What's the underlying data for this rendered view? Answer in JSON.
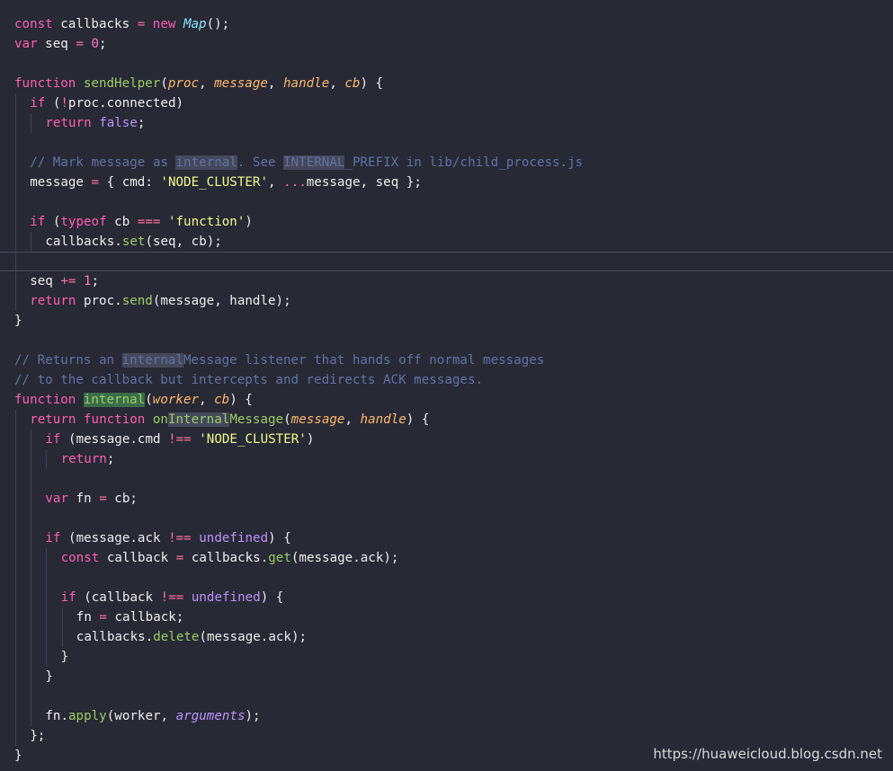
{
  "colors": {
    "background": "#272935",
    "plain": "#eeeeee",
    "keyword": "#ff5faf",
    "control": "#c792ea",
    "function": "#9ccc65",
    "param": "#ffb86c",
    "string": "#f1fa8c",
    "number": "#ff79c6",
    "comment": "#6272a4",
    "class": "#8be9fd",
    "operator": "#ff6e9e",
    "constant": "#bd93f9"
  },
  "watermark": "https://huaweicloud.blog.csdn.net",
  "lines": [
    {
      "indent": 0,
      "tokens": [
        {
          "t": "const",
          "c": "keyword"
        },
        {
          "t": " callbacks ",
          "c": "plain"
        },
        {
          "t": "=",
          "c": "operator"
        },
        {
          "t": " ",
          "c": "plain"
        },
        {
          "t": "new",
          "c": "keyword"
        },
        {
          "t": " ",
          "c": "plain"
        },
        {
          "t": "Map",
          "c": "class"
        },
        {
          "t": "();",
          "c": "plain"
        }
      ]
    },
    {
      "indent": 0,
      "tokens": [
        {
          "t": "var",
          "c": "keyword"
        },
        {
          "t": " seq ",
          "c": "plain"
        },
        {
          "t": "=",
          "c": "operator"
        },
        {
          "t": " ",
          "c": "plain"
        },
        {
          "t": "0",
          "c": "number"
        },
        {
          "t": ";",
          "c": "plain"
        }
      ]
    },
    {
      "indent": 0,
      "tokens": []
    },
    {
      "indent": 0,
      "tokens": [
        {
          "t": "function",
          "c": "keyword"
        },
        {
          "t": " ",
          "c": "plain"
        },
        {
          "t": "sendHelper",
          "c": "function"
        },
        {
          "t": "(",
          "c": "plain"
        },
        {
          "t": "proc",
          "c": "param"
        },
        {
          "t": ", ",
          "c": "plain"
        },
        {
          "t": "message",
          "c": "param"
        },
        {
          "t": ", ",
          "c": "plain"
        },
        {
          "t": "handle",
          "c": "param"
        },
        {
          "t": ", ",
          "c": "plain"
        },
        {
          "t": "cb",
          "c": "param"
        },
        {
          "t": ") {",
          "c": "plain"
        }
      ]
    },
    {
      "indent": 1,
      "tokens": [
        {
          "t": "if",
          "c": "keyword"
        },
        {
          "t": " (",
          "c": "plain"
        },
        {
          "t": "!",
          "c": "operator"
        },
        {
          "t": "proc.connected)",
          "c": "plain"
        }
      ]
    },
    {
      "indent": 2,
      "tokens": [
        {
          "t": "return",
          "c": "keyword"
        },
        {
          "t": " ",
          "c": "plain"
        },
        {
          "t": "false",
          "c": "constant"
        },
        {
          "t": ";",
          "c": "plain"
        }
      ]
    },
    {
      "indent": 1,
      "tokens": []
    },
    {
      "indent": 1,
      "tokens": [
        {
          "t": "// Mark message as ",
          "c": "comment"
        },
        {
          "t": "internal",
          "c": "comment",
          "hl": true
        },
        {
          "t": ". See ",
          "c": "comment"
        },
        {
          "t": "INTERNAL",
          "c": "comment",
          "hl": true
        },
        {
          "t": "_PREFIX in lib/child_process.js",
          "c": "comment"
        }
      ]
    },
    {
      "indent": 1,
      "tokens": [
        {
          "t": "message ",
          "c": "plain"
        },
        {
          "t": "=",
          "c": "operator"
        },
        {
          "t": " { cmd: ",
          "c": "plain"
        },
        {
          "t": "'NODE_CLUSTER'",
          "c": "string"
        },
        {
          "t": ", ",
          "c": "plain"
        },
        {
          "t": "...",
          "c": "operator"
        },
        {
          "t": "message, seq };",
          "c": "plain"
        }
      ]
    },
    {
      "indent": 1,
      "tokens": []
    },
    {
      "indent": 1,
      "tokens": [
        {
          "t": "if",
          "c": "keyword"
        },
        {
          "t": " (",
          "c": "plain"
        },
        {
          "t": "typeof",
          "c": "keyword"
        },
        {
          "t": " cb ",
          "c": "plain"
        },
        {
          "t": "===",
          "c": "operator"
        },
        {
          "t": " ",
          "c": "plain"
        },
        {
          "t": "'function'",
          "c": "string"
        },
        {
          "t": ")",
          "c": "plain"
        }
      ]
    },
    {
      "indent": 2,
      "tokens": [
        {
          "t": "callbacks.",
          "c": "plain"
        },
        {
          "t": "set",
          "c": "function"
        },
        {
          "t": "(seq, cb);",
          "c": "plain"
        }
      ]
    },
    {
      "indent": 1,
      "tokens": [],
      "current": true
    },
    {
      "indent": 1,
      "tokens": [
        {
          "t": "seq ",
          "c": "plain"
        },
        {
          "t": "+=",
          "c": "operator"
        },
        {
          "t": " ",
          "c": "plain"
        },
        {
          "t": "1",
          "c": "number"
        },
        {
          "t": ";",
          "c": "plain"
        }
      ]
    },
    {
      "indent": 1,
      "tokens": [
        {
          "t": "return",
          "c": "keyword"
        },
        {
          "t": " proc.",
          "c": "plain"
        },
        {
          "t": "send",
          "c": "function"
        },
        {
          "t": "(message, handle);",
          "c": "plain"
        }
      ]
    },
    {
      "indent": 0,
      "tokens": [
        {
          "t": "}",
          "c": "plain"
        }
      ]
    },
    {
      "indent": 0,
      "tokens": []
    },
    {
      "indent": 0,
      "tokens": [
        {
          "t": "// Returns an ",
          "c": "comment"
        },
        {
          "t": "internal",
          "c": "comment",
          "hl": true
        },
        {
          "t": "Message listener that hands off normal messages",
          "c": "comment"
        }
      ]
    },
    {
      "indent": 0,
      "tokens": [
        {
          "t": "// to the callback but intercepts and redirects ACK messages.",
          "c": "comment"
        }
      ]
    },
    {
      "indent": 0,
      "tokens": [
        {
          "t": "function",
          "c": "keyword"
        },
        {
          "t": " ",
          "c": "plain"
        },
        {
          "t": "internal",
          "c": "function",
          "hls": true
        },
        {
          "t": "(",
          "c": "plain"
        },
        {
          "t": "worker",
          "c": "param"
        },
        {
          "t": ", ",
          "c": "plain"
        },
        {
          "t": "cb",
          "c": "param"
        },
        {
          "t": ") {",
          "c": "plain"
        }
      ]
    },
    {
      "indent": 1,
      "tokens": [
        {
          "t": "return",
          "c": "keyword"
        },
        {
          "t": " ",
          "c": "plain"
        },
        {
          "t": "function",
          "c": "keyword"
        },
        {
          "t": " ",
          "c": "plain"
        },
        {
          "t": "on",
          "c": "function"
        },
        {
          "t": "Internal",
          "c": "function",
          "hl": true
        },
        {
          "t": "Message",
          "c": "function"
        },
        {
          "t": "(",
          "c": "plain"
        },
        {
          "t": "message",
          "c": "param"
        },
        {
          "t": ", ",
          "c": "plain"
        },
        {
          "t": "handle",
          "c": "param"
        },
        {
          "t": ") {",
          "c": "plain"
        }
      ]
    },
    {
      "indent": 2,
      "tokens": [
        {
          "t": "if",
          "c": "keyword"
        },
        {
          "t": " (message.cmd ",
          "c": "plain"
        },
        {
          "t": "!==",
          "c": "operator"
        },
        {
          "t": " ",
          "c": "plain"
        },
        {
          "t": "'NODE_CLUSTER'",
          "c": "string"
        },
        {
          "t": ")",
          "c": "plain"
        }
      ]
    },
    {
      "indent": 3,
      "tokens": [
        {
          "t": "return",
          "c": "keyword"
        },
        {
          "t": ";",
          "c": "plain"
        }
      ]
    },
    {
      "indent": 2,
      "tokens": []
    },
    {
      "indent": 2,
      "tokens": [
        {
          "t": "var",
          "c": "keyword"
        },
        {
          "t": " fn ",
          "c": "plain"
        },
        {
          "t": "=",
          "c": "operator"
        },
        {
          "t": " cb;",
          "c": "plain"
        }
      ]
    },
    {
      "indent": 2,
      "tokens": []
    },
    {
      "indent": 2,
      "tokens": [
        {
          "t": "if",
          "c": "keyword"
        },
        {
          "t": " (message.ack ",
          "c": "plain"
        },
        {
          "t": "!==",
          "c": "operator"
        },
        {
          "t": " ",
          "c": "plain"
        },
        {
          "t": "undefined",
          "c": "constant"
        },
        {
          "t": ") {",
          "c": "plain"
        }
      ]
    },
    {
      "indent": 3,
      "tokens": [
        {
          "t": "const",
          "c": "keyword"
        },
        {
          "t": " callback ",
          "c": "plain"
        },
        {
          "t": "=",
          "c": "operator"
        },
        {
          "t": " callbacks.",
          "c": "plain"
        },
        {
          "t": "get",
          "c": "function"
        },
        {
          "t": "(message.ack);",
          "c": "plain"
        }
      ]
    },
    {
      "indent": 3,
      "tokens": []
    },
    {
      "indent": 3,
      "tokens": [
        {
          "t": "if",
          "c": "keyword"
        },
        {
          "t": " (callback ",
          "c": "plain"
        },
        {
          "t": "!==",
          "c": "operator"
        },
        {
          "t": " ",
          "c": "plain"
        },
        {
          "t": "undefined",
          "c": "constant"
        },
        {
          "t": ") {",
          "c": "plain"
        }
      ]
    },
    {
      "indent": 4,
      "tokens": [
        {
          "t": "fn ",
          "c": "plain"
        },
        {
          "t": "=",
          "c": "operator"
        },
        {
          "t": " callback;",
          "c": "plain"
        }
      ]
    },
    {
      "indent": 4,
      "tokens": [
        {
          "t": "callbacks.",
          "c": "plain"
        },
        {
          "t": "delete",
          "c": "function"
        },
        {
          "t": "(message.ack);",
          "c": "plain"
        }
      ]
    },
    {
      "indent": 3,
      "tokens": [
        {
          "t": "}",
          "c": "plain"
        }
      ]
    },
    {
      "indent": 2,
      "tokens": [
        {
          "t": "}",
          "c": "plain"
        }
      ]
    },
    {
      "indent": 2,
      "tokens": []
    },
    {
      "indent": 2,
      "tokens": [
        {
          "t": "fn.",
          "c": "plain"
        },
        {
          "t": "apply",
          "c": "function"
        },
        {
          "t": "(worker, ",
          "c": "plain"
        },
        {
          "t": "arguments",
          "c": "constant"
        },
        {
          "t": ");",
          "c": "plain"
        }
      ]
    },
    {
      "indent": 1,
      "tokens": [
        {
          "t": "};",
          "c": "plain"
        }
      ]
    },
    {
      "indent": 0,
      "tokens": [
        {
          "t": "}",
          "c": "plain"
        }
      ]
    }
  ]
}
